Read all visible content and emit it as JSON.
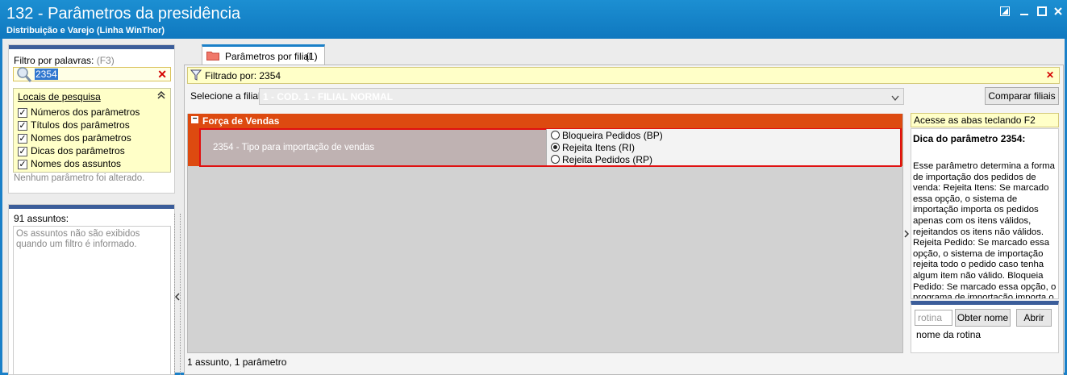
{
  "window": {
    "title": "132 - Parâmetros da presidência",
    "subtitle": "Distribuição e Varejo (Linha WinThor)"
  },
  "filter": {
    "label": "Filtro por palavras:",
    "shortcut": "(F3)",
    "value": "2354"
  },
  "locais": {
    "title": "Locais de pesquisa",
    "items": [
      {
        "label": "Números dos parâmetros",
        "checked": true
      },
      {
        "label": "Títulos dos parâmetros",
        "checked": true
      },
      {
        "label": "Nomes dos parâmetros",
        "checked": true
      },
      {
        "label": "Dicas dos parâmetros",
        "checked": true
      },
      {
        "label": "Nomes dos assuntos",
        "checked": true
      }
    ]
  },
  "status_left": "Nenhum parâmetro foi alterado.",
  "assuntos": {
    "count_label": "91 assuntos:",
    "info": "Os assuntos não são exibidos quando um filtro é informado."
  },
  "tab": {
    "label": "Parâmetros por filial",
    "count": "(1)"
  },
  "filtered_by": "Filtrado por: 2354",
  "filial": {
    "label": "Selecione a filial:",
    "value": "1 - COD. 1 - FILIAL NORMAL"
  },
  "compare_button": "Comparar filiais",
  "group": {
    "title": "Força de Vendas",
    "toggle": "−"
  },
  "parameter": {
    "label": "2354 - Tipo para importação de vendas",
    "options": [
      {
        "label": "Bloqueira Pedidos (BP)",
        "selected": false
      },
      {
        "label": "Rejeita Itens (RI)",
        "selected": true
      },
      {
        "label": "Rejeita Pedidos (RP)",
        "selected": false
      }
    ]
  },
  "status_bottom": "1 assunto, 1 parâmetro",
  "hint": "Acesse as abas teclando F2",
  "dica": {
    "title": "Dica do parâmetro 2354:",
    "text": "Esse parâmetro determina a forma de importação dos pedidos de venda: Rejeita Itens: Se marcado essa opção, o sistema de importação importa os pedidos apenas com os itens válidos, rejeitandos os itens não válidos. Rejeita Pedido: Se marcado essa opção, o sistema de importação rejeita todo o pedido caso tenha algum item não válido. Bloqueia Pedido: Se marcado essa opção, o programa de importação importa o pedido como bloqueado no sistema"
  },
  "rotina": {
    "placeholder": "rotina",
    "obter_button": "Obter nome",
    "abrir_button": "Abrir",
    "name_label": "nome da rotina"
  }
}
